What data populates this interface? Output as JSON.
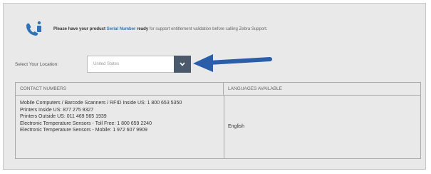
{
  "notice": {
    "prefix": "Please have your product",
    "highlight": "Serial Number",
    "bold_suffix": "ready",
    "rest": "for support entitlement validation before calling Zebra Support."
  },
  "location": {
    "label": "Select Your Location:",
    "selected": "United States"
  },
  "table": {
    "headers": [
      "CONTACT NUMBERS",
      "LANGUAGES AVAILABLE"
    ],
    "contacts": [
      "Mobile Computers / Barcode Scanners / RFID Inside US: 1 800 653 5350",
      "Printers Inside US: 877 275 9327",
      "Printers Outside US: 011 469 565 1939",
      "Electronic Temperature Sensors - Toll Free: 1 800 659 2240",
      "Electronic Temperature Sensors - Mobile: 1 972 607 9909"
    ],
    "language": "English"
  },
  "colors": {
    "accent": "#2f73b6",
    "arrow": "#2a5ea8",
    "select_button": "#4a5a6c"
  },
  "icons": [
    "phone-icon",
    "chevron-down-icon",
    "arrow-left-icon"
  ]
}
